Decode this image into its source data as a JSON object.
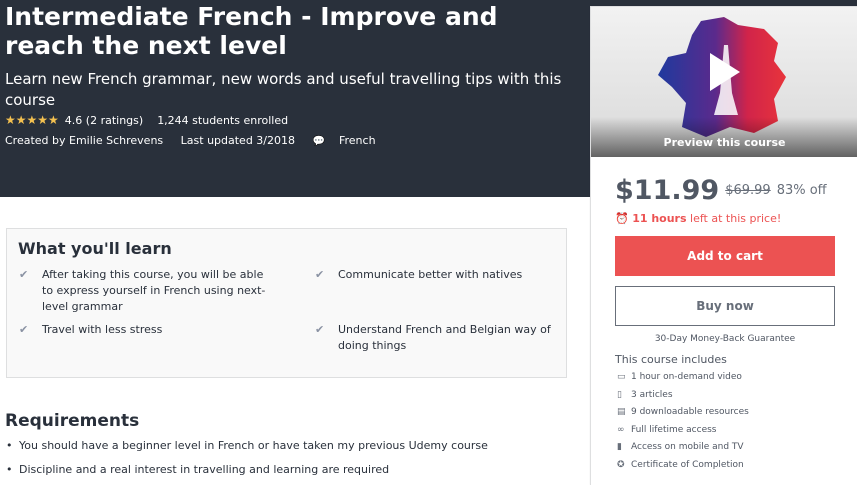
{
  "course": {
    "title": "Intermediate French - Improve and reach the next level",
    "subtitle": "Learn new French grammar, new words and useful travelling tips with this course",
    "stars": "★★★★★",
    "rating": "4.6 (2 ratings)",
    "enrolled": "1,244 students enrolled",
    "created_by": "Created by Emilie Schrevens",
    "last_updated": "Last updated 3/2018",
    "language": "French"
  },
  "learn": {
    "heading": "What you'll learn",
    "items": [
      "After taking this course, you will be able to express yourself in French using next-level grammar",
      "Communicate better with natives",
      "Travel with less stress",
      "Understand French and Belgian way of doing things"
    ]
  },
  "requirements": {
    "heading": "Requirements",
    "items": [
      "You should have a beginner level in French or have taken my previous Udemy course",
      "Discipline and a real interest in travelling and learning are required"
    ]
  },
  "sidebar": {
    "preview_label": "Preview this course",
    "price": "$11.99",
    "original_price": "$69.99",
    "discount": "83% off",
    "timer_bold": "11 hours",
    "timer_rest": " left at this price!",
    "add_to_cart": "Add to cart",
    "buy_now": "Buy now",
    "guarantee": "30-Day Money-Back Guarantee",
    "includes_heading": "This course includes",
    "includes": [
      {
        "icon": "video-icon",
        "text": "1 hour on-demand video"
      },
      {
        "icon": "file-icon",
        "text": "3 articles"
      },
      {
        "icon": "download-icon",
        "text": "9 downloadable resources"
      },
      {
        "icon": "infinity-icon",
        "text": "Full lifetime access"
      },
      {
        "icon": "mobile-icon",
        "text": "Access on mobile and TV"
      },
      {
        "icon": "certificate-icon",
        "text": "Certificate of Completion"
      }
    ]
  },
  "colors": {
    "hero_bg": "#29303b",
    "accent_red": "#ec5252",
    "star": "#f4c150"
  }
}
